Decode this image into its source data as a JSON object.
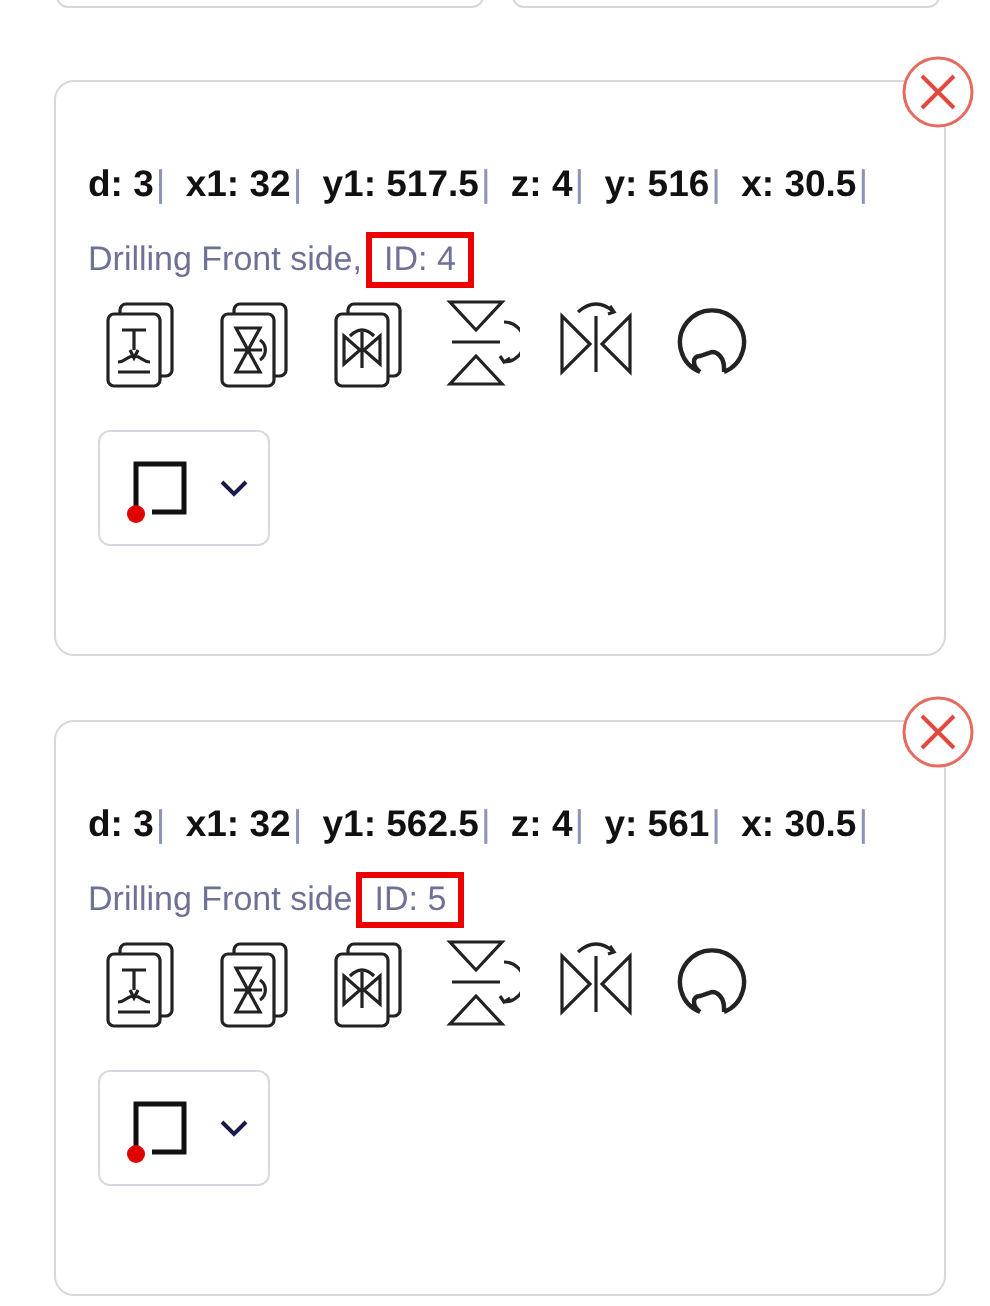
{
  "top_cards": [
    {
      "kind": "panel"
    },
    {
      "kind": "panel"
    }
  ],
  "operations": [
    {
      "fields": [
        {
          "text": "d: 3"
        },
        {
          "text": "x1: 32"
        },
        {
          "text": "y1: 517.5"
        },
        {
          "text": "z: 4"
        },
        {
          "text": "y: 516"
        },
        {
          "text": "x: 30.5"
        }
      ],
      "separator": "|",
      "description": "Drilling Front side,",
      "id_text": "ID: 4",
      "id_highlighted": true
    },
    {
      "fields": [
        {
          "text": "d: 3"
        },
        {
          "text": "x1: 32"
        },
        {
          "text": "y1: 562.5"
        },
        {
          "text": "z: 4"
        },
        {
          "text": "y: 561"
        },
        {
          "text": "x: 30.5"
        }
      ],
      "separator": "|",
      "description": "Drilling Front side",
      "id_text": "ID: 5",
      "id_highlighted": true
    }
  ]
}
